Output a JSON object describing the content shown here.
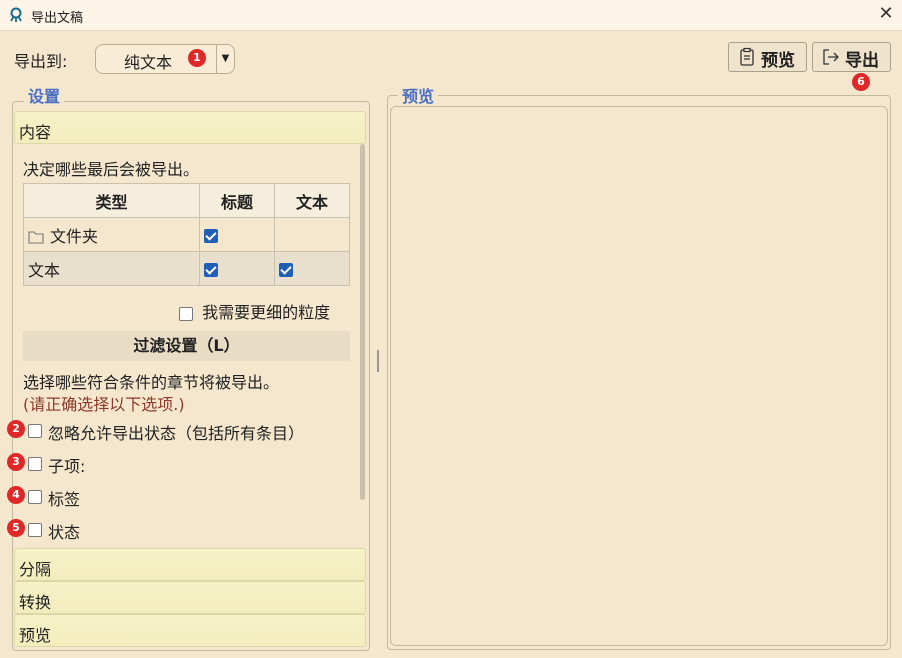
{
  "window": {
    "title": "导出文稿",
    "close_glyph": "✕",
    "icon": "app-logo-icon"
  },
  "toolbar": {
    "export_to_label": "导出到:",
    "format_value": "纯文本",
    "format_badge": "1",
    "preview_button": "预览",
    "export_button": "导出",
    "export_badge": "6"
  },
  "settings": {
    "group_title": "设置",
    "content_section": "内容",
    "description": "决定哪些最后会被导出。",
    "table": {
      "headers": [
        "类型",
        "标题",
        "文本"
      ],
      "rows": [
        {
          "type": "文件夹",
          "title_checked": true,
          "text_checked": false
        },
        {
          "type": "文本",
          "title_checked": true,
          "text_checked": true
        }
      ]
    },
    "granularity_label": "我需要更细的粒度",
    "filter_header": "过滤设置（L）",
    "filter_desc": "选择哪些符合条件的章节将被导出。",
    "filter_note": "(请正确选择以下选项.)",
    "filters": [
      {
        "badge": "2",
        "label": "忽略允许导出状态（包括所有条目）"
      },
      {
        "badge": "3",
        "label": "子项:"
      },
      {
        "badge": "4",
        "label": "标签"
      },
      {
        "badge": "5",
        "label": "状态"
      }
    ],
    "sections": [
      "分隔",
      "转换",
      "预览"
    ]
  },
  "preview": {
    "group_title": "预览"
  },
  "colors": {
    "background": "#f5e7cd",
    "accent": "#4a6fc5",
    "badge": "#e02828",
    "note": "#8b3a2b"
  }
}
